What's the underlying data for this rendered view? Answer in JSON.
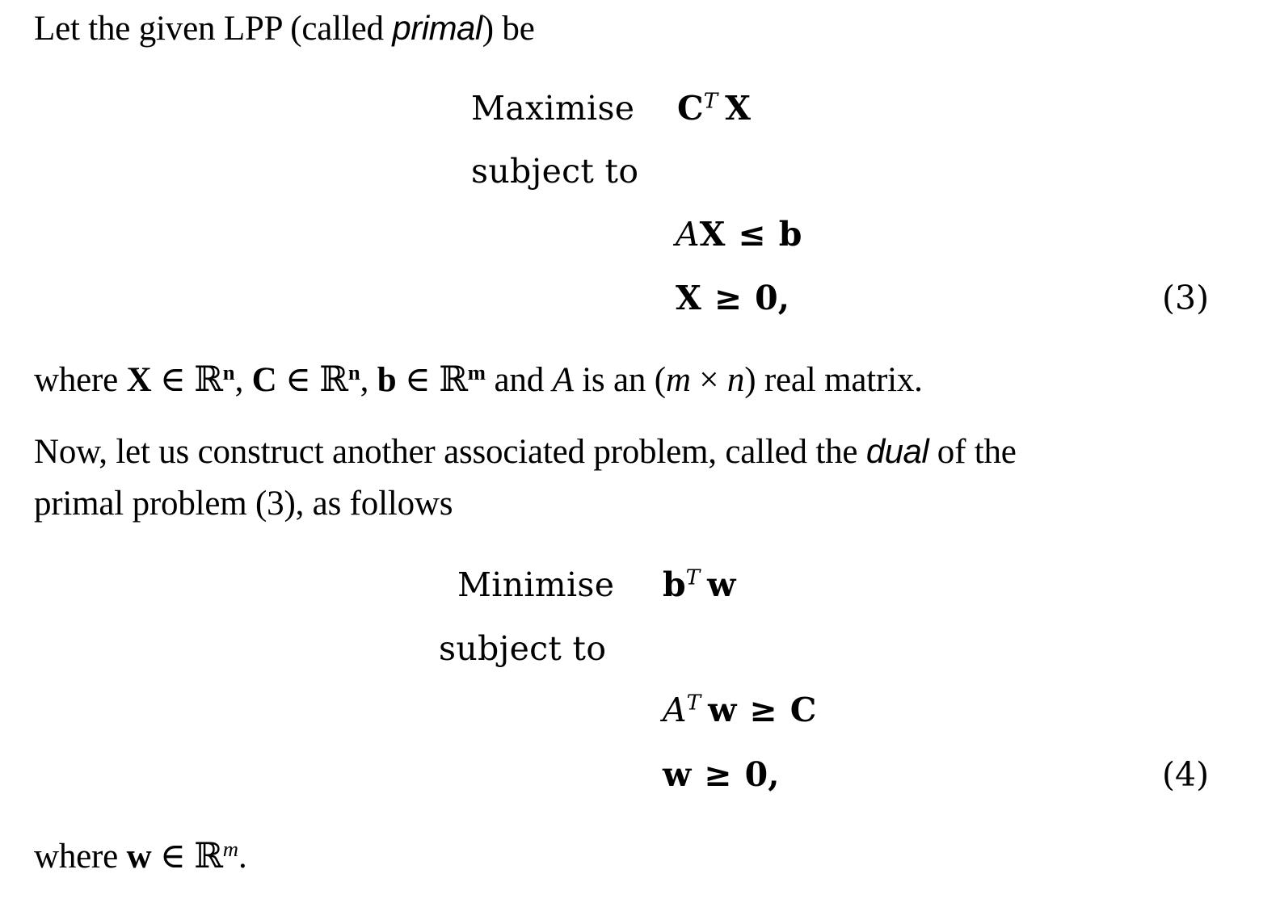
{
  "document": {
    "background_color": "#ffffff",
    "text_color": "#000000"
  },
  "paragraphs": {
    "intro": {
      "before_emph": "Let the given LPP (called ",
      "emph": "primal",
      "after_emph": ") be"
    },
    "where_primal": {
      "part1": "where ",
      "var_x": "X",
      "in1": " ∈ ",
      "set1": "ℝ",
      "sup1": "n",
      "sep1": ", ",
      "var_c": "C",
      "in2": " ∈ ",
      "set2": "ℝ",
      "sup2": "n",
      "sep2": ", ",
      "var_b": "b",
      "in3": " ∈ ",
      "set3": "ℝ",
      "sup3": "m",
      "mid": " and ",
      "matrix_a": "A",
      "tail1": " is an (",
      "dim_m": "m",
      "times": " × ",
      "dim_n": "n",
      "tail2": ") real matrix."
    },
    "dual_intro_line1": {
      "before_emph": "Now, let us construct another associated problem, called the ",
      "emph": "dual",
      "after_emph": " of the"
    },
    "dual_intro_line2": {
      "text": "primal problem (3), as follows"
    },
    "where_dual": {
      "part1": "where ",
      "var_w": "w",
      "in1": " ∈ ",
      "set1": "ℝ",
      "sup1": "m",
      "tail": "."
    }
  },
  "equations": [
    {
      "id": "primal",
      "number": "(3)",
      "objective_label": "Maximise",
      "objective": {
        "vector1": "C",
        "transpose": "T",
        "vector2": "X"
      },
      "subject_to_label": "subject to",
      "constraints": [
        {
          "id": "primal-constraint-1",
          "matrix": "A",
          "vector": "X",
          "relation": "≤",
          "rhs": "b"
        },
        {
          "id": "primal-constraint-2",
          "vector": "X",
          "relation": "≥",
          "rhs": "0",
          "trailing": ","
        }
      ]
    },
    {
      "id": "dual",
      "number": "(4)",
      "objective_label": "Minimise",
      "objective": {
        "vector1": "b",
        "transpose": "T",
        "vector2": "w"
      },
      "subject_to_label": "subject to",
      "constraints": [
        {
          "id": "dual-constraint-1",
          "matrix": "A",
          "transpose": "T",
          "vector": "w",
          "relation": "≥",
          "rhs": "C"
        },
        {
          "id": "dual-constraint-2",
          "vector": "w",
          "relation": "≥",
          "rhs": "0",
          "trailing": ","
        }
      ]
    }
  ]
}
